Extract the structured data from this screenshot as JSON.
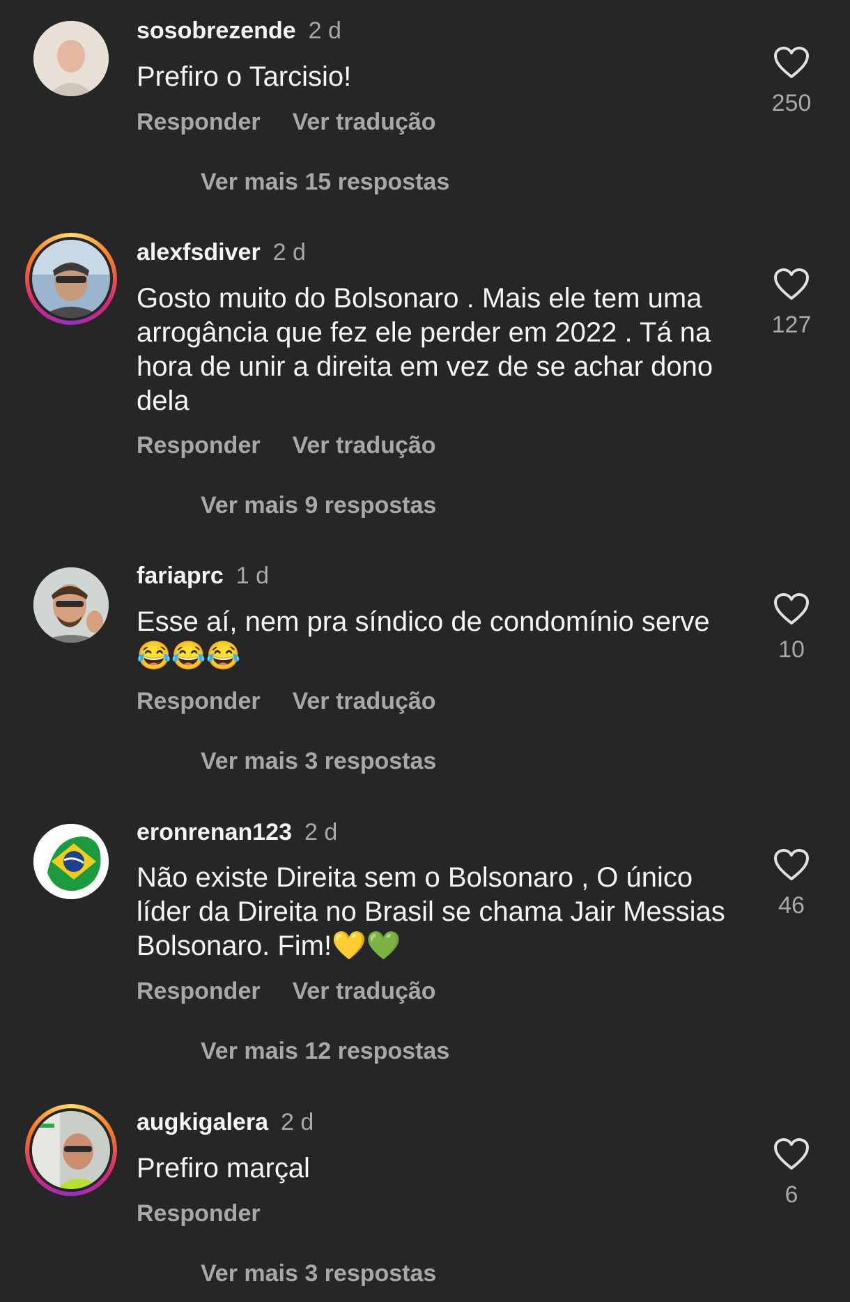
{
  "labels": {
    "reply": "Responder",
    "translate": "Ver tradução"
  },
  "comments": [
    {
      "username": "sosobrezende",
      "time": "2 d",
      "text": "Prefiro o Tarcisio!",
      "likes": "250",
      "more_replies": "Ver mais 15 respostas"
    },
    {
      "username": "alexfsdiver",
      "time": "2 d",
      "text": "Gosto muito do Bolsonaro . Mais ele tem uma arrogância que fez ele perder em 2022 . Tá na hora de unir a direita em vez de se achar dono dela",
      "likes": "127",
      "more_replies": "Ver mais 9 respostas"
    },
    {
      "username": "fariaprc",
      "time": "1 d",
      "text": "Esse aí, nem pra síndico de condomínio serve 😂😂😂",
      "likes": "10",
      "more_replies": "Ver mais 3 respostas"
    },
    {
      "username": "eronrenan123",
      "time": "2 d",
      "text": "Não existe Direita sem o Bolsonaro , O único líder da Direita no Brasil se chama Jair Messias Bolsonaro. Fim!💛💚",
      "likes": "46",
      "more_replies": "Ver mais 12 respostas"
    },
    {
      "username": "augkigalera",
      "time": "2 d",
      "text": "Prefiro marçal",
      "likes": "6",
      "more_replies": "Ver mais 3 respostas"
    }
  ]
}
